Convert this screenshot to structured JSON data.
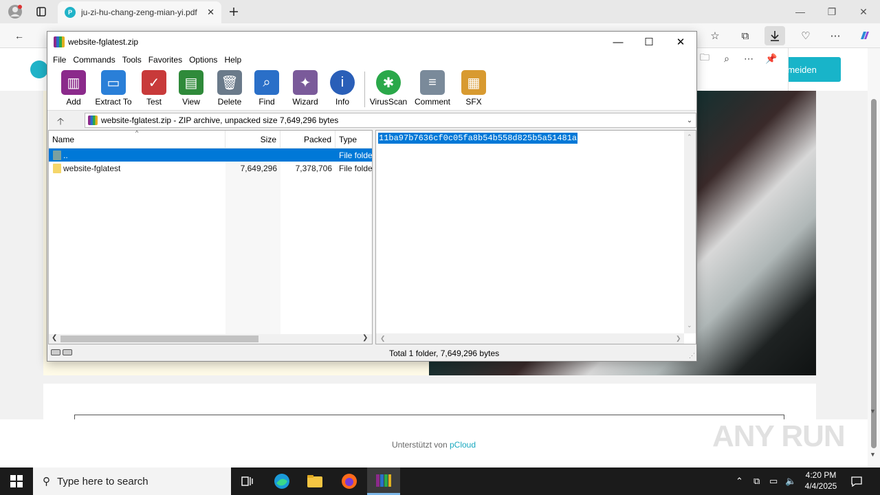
{
  "browser": {
    "tab_title": "ju-zi-hu-chang-zeng-mian-yi.pdf",
    "tab_favicon": "P"
  },
  "webpage": {
    "login_button": "nmeiden",
    "footer_prefix": "Unterstützt von",
    "footer_brand": "pCloud",
    "watermark": "ANY RUN"
  },
  "winrar": {
    "title": "website-fglatest.zip",
    "menu": [
      "File",
      "Commands",
      "Tools",
      "Favorites",
      "Options",
      "Help"
    ],
    "toolbar": [
      {
        "label": "Add",
        "icon": "add-icon",
        "color": "#8b2a8b"
      },
      {
        "label": "Extract To",
        "icon": "extract-to-icon",
        "color": "#2a7fd8"
      },
      {
        "label": "Test",
        "icon": "test-icon",
        "color": "#c83a3a"
      },
      {
        "label": "View",
        "icon": "view-icon",
        "color": "#2f8a3a"
      },
      {
        "label": "Delete",
        "icon": "delete-icon",
        "color": "#6a7a8a"
      },
      {
        "label": "Find",
        "icon": "find-icon",
        "color": "#2a6fc8"
      },
      {
        "label": "Wizard",
        "icon": "wizard-icon",
        "color": "#7a5a9a"
      },
      {
        "label": "Info",
        "icon": "info-icon",
        "color": "#2a5fb8"
      },
      {
        "label": "VirusScan",
        "icon": "virusscan-icon",
        "color": "#2aa84a"
      },
      {
        "label": "Comment",
        "icon": "comment-icon",
        "color": "#7a8a9a"
      },
      {
        "label": "SFX",
        "icon": "sfx-icon",
        "color": "#d89a30"
      }
    ],
    "address": "website-fglatest.zip - ZIP archive, unpacked size 7,649,296 bytes",
    "columns": {
      "name": "Name",
      "size": "Size",
      "packed": "Packed",
      "type": "Type"
    },
    "rows": [
      {
        "name": "..",
        "size": "",
        "packed": "",
        "type": "File folder",
        "selected": true
      },
      {
        "name": "website-fglatest",
        "size": "7,649,296",
        "packed": "7,378,706",
        "type": "File folder",
        "selected": false
      }
    ],
    "comment": "11ba97b7636cf0c05fa8b54b558d825b5a51481a",
    "status": "Total 1 folder, 7,649,296 bytes"
  },
  "taskbar": {
    "search_placeholder": "Type here to search",
    "time": "4:20 PM",
    "date": "4/4/2025"
  }
}
